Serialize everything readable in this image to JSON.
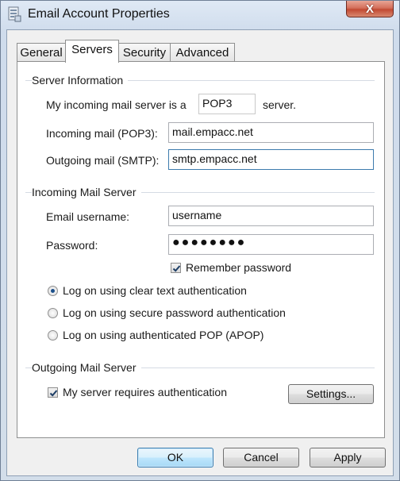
{
  "window": {
    "title": "Email Account Properties",
    "close_glyph": "X"
  },
  "tabs": [
    {
      "label": "General",
      "active": false
    },
    {
      "label": "Servers",
      "active": true
    },
    {
      "label": "Security",
      "active": false
    },
    {
      "label": "Advanced",
      "active": false
    }
  ],
  "server_info": {
    "heading": "Server Information",
    "incoming_type_label": "My incoming mail server is a",
    "incoming_type_value": "POP3",
    "incoming_type_suffix": "server.",
    "incoming_label": "Incoming mail (POP3):",
    "incoming_value": "mail.empacc.net",
    "outgoing_label": "Outgoing mail (SMTP):",
    "outgoing_value": "smtp.empacc.net"
  },
  "incoming_mail_server": {
    "heading": "Incoming Mail Server",
    "username_label": "Email username:",
    "username_value": "username",
    "password_label": "Password:",
    "password_value": "●●●●●●●●",
    "remember_label": "Remember password",
    "remember_checked": true,
    "auth_options": [
      {
        "label": "Log on using clear text authentication",
        "selected": true
      },
      {
        "label": "Log on using secure password authentication",
        "selected": false
      },
      {
        "label": "Log on using authenticated POP (APOP)",
        "selected": false
      }
    ]
  },
  "outgoing_mail_server": {
    "heading": "Outgoing Mail Server",
    "requires_auth_label": "My server requires authentication",
    "requires_auth_checked": true,
    "settings_button": "Settings..."
  },
  "footer": {
    "ok": "OK",
    "cancel": "Cancel",
    "apply": "Apply"
  },
  "colors": {
    "accent": "#3c7fb1",
    "close_red": "#c24a33"
  }
}
